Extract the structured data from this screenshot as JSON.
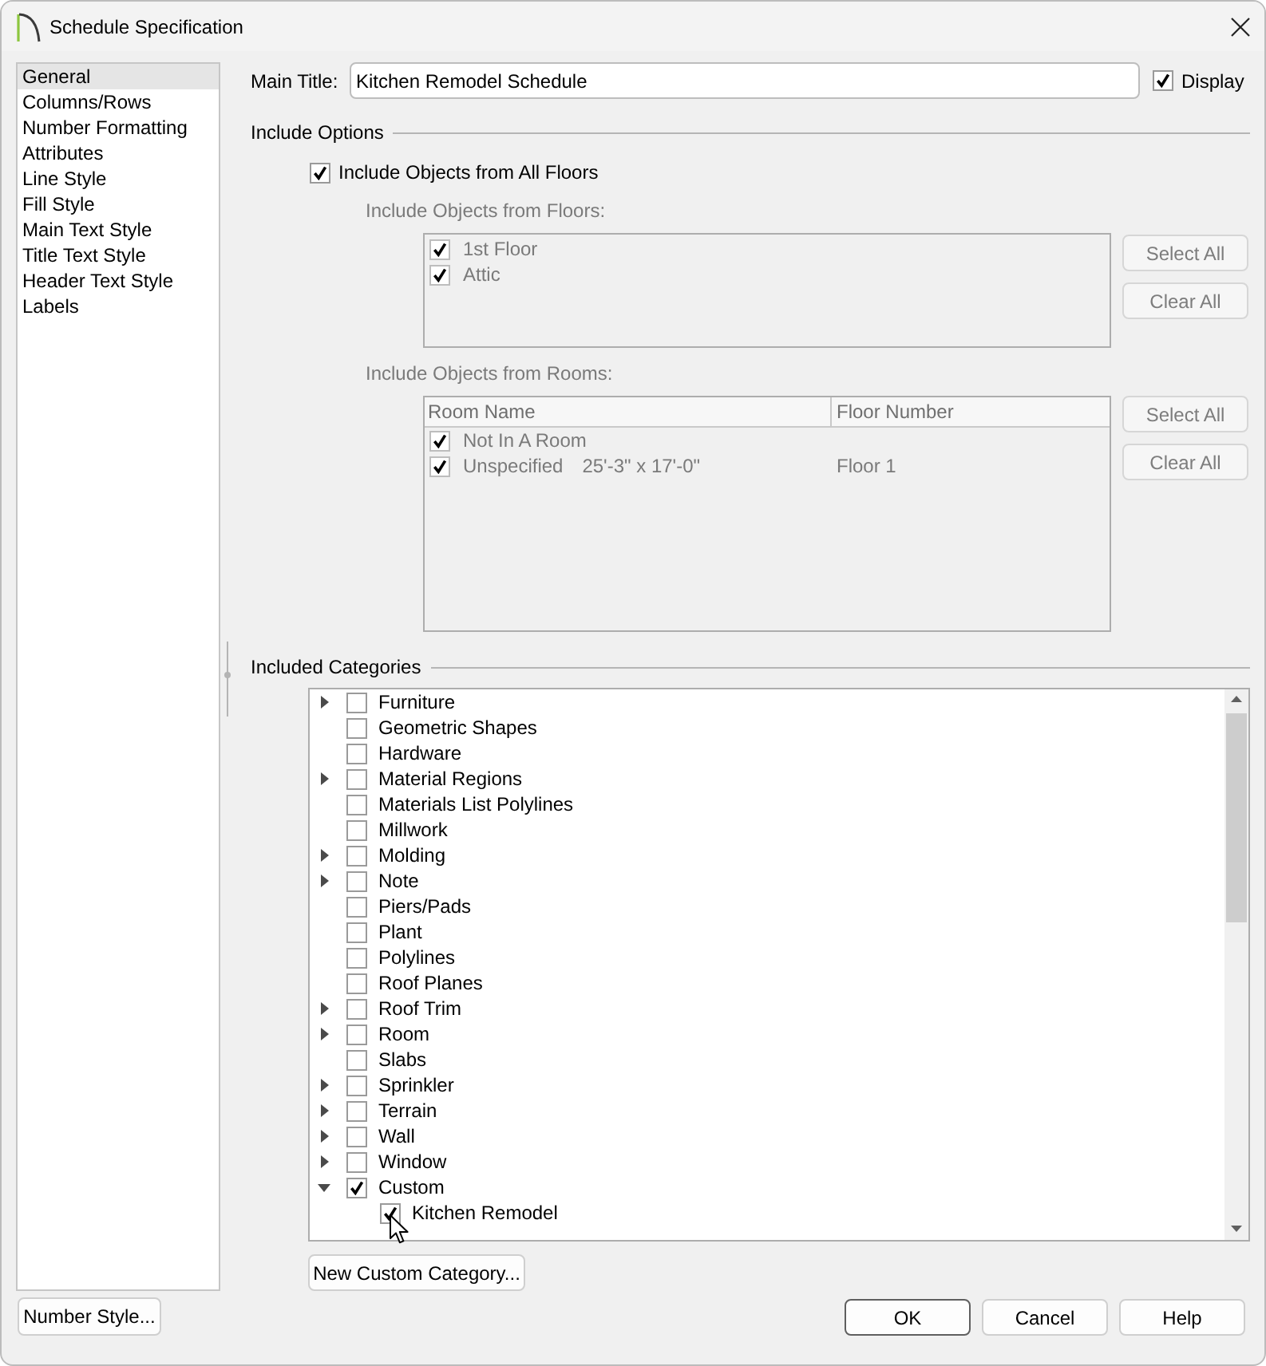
{
  "window": {
    "title": "Schedule Specification"
  },
  "sidebar": {
    "items": [
      {
        "label": "General",
        "selected": true
      },
      {
        "label": "Columns/Rows",
        "selected": false
      },
      {
        "label": "Number Formatting",
        "selected": false
      },
      {
        "label": "Attributes",
        "selected": false
      },
      {
        "label": "Line Style",
        "selected": false
      },
      {
        "label": "Fill Style",
        "selected": false
      },
      {
        "label": "Main Text Style",
        "selected": false
      },
      {
        "label": "Title Text Style",
        "selected": false
      },
      {
        "label": "Header Text Style",
        "selected": false
      },
      {
        "label": "Labels",
        "selected": false
      }
    ]
  },
  "main_title": {
    "label": "Main Title:",
    "value": "Kitchen Remodel Schedule",
    "display": {
      "label": "Display",
      "checked": true
    }
  },
  "include_options": {
    "heading": "Include Options",
    "all_floors": {
      "label": "Include Objects from All Floors",
      "checked": true
    },
    "floors": {
      "label": "Include Objects from Floors:",
      "disabled": true,
      "items": [
        {
          "label": "1st Floor",
          "checked": true
        },
        {
          "label": "Attic",
          "checked": true
        }
      ],
      "buttons": [
        "Select All",
        "Clear All"
      ]
    },
    "rooms": {
      "label": "Include Objects from Rooms:",
      "disabled": true,
      "columns": [
        "Room Name",
        "Floor Number"
      ],
      "rows": [
        {
          "name": "Not In A Room",
          "checked": true
        },
        {
          "name": "Unspecified",
          "dimensions": "25'-3\" x 17'-0\"",
          "floor_number": "Floor 1",
          "checked": true
        }
      ],
      "buttons": [
        "Select All",
        "Clear All"
      ]
    }
  },
  "included_categories": {
    "heading": "Included Categories",
    "items": [
      {
        "label": "Furniture",
        "checked": false,
        "expanded": false
      },
      {
        "label": "Geometric Shapes",
        "checked": false
      },
      {
        "label": "Hardware",
        "checked": false
      },
      {
        "label": "Material Regions",
        "checked": false,
        "expanded": false
      },
      {
        "label": "Materials List Polylines",
        "checked": false
      },
      {
        "label": "Millwork",
        "checked": false
      },
      {
        "label": "Molding",
        "checked": false,
        "expanded": false
      },
      {
        "label": "Note",
        "checked": false,
        "expanded": false
      },
      {
        "label": "Piers/Pads",
        "checked": false
      },
      {
        "label": "Plant",
        "checked": false
      },
      {
        "label": "Polylines",
        "checked": false
      },
      {
        "label": "Roof Planes",
        "checked": false
      },
      {
        "label": "Roof Trim",
        "checked": false,
        "expanded": false
      },
      {
        "label": "Room",
        "checked": false,
        "expanded": false
      },
      {
        "label": "Slabs",
        "checked": false
      },
      {
        "label": "Sprinkler",
        "checked": false,
        "expanded": false
      },
      {
        "label": "Terrain",
        "checked": false,
        "expanded": false
      },
      {
        "label": "Wall",
        "checked": false,
        "expanded": false
      },
      {
        "label": "Window",
        "checked": false,
        "expanded": false
      },
      {
        "label": "Custom",
        "checked": true,
        "expanded": true,
        "children": [
          {
            "label": "Kitchen Remodel",
            "checked": true
          }
        ]
      }
    ],
    "new_category_button": "New Custom Category..."
  },
  "footer": {
    "number_style_button": "Number Style...",
    "buttons": [
      {
        "label": "OK",
        "default": true
      },
      {
        "label": "Cancel",
        "default": false
      },
      {
        "label": "Help",
        "default": false
      }
    ]
  }
}
